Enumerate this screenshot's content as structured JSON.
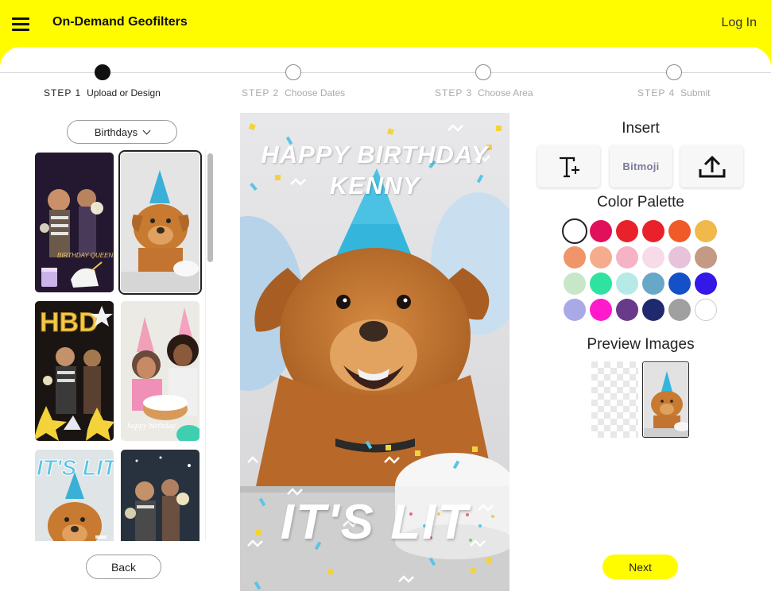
{
  "header": {
    "title": "On-Demand Geofilters",
    "login_label": "Log In"
  },
  "steps": [
    {
      "num": "STEP 1",
      "label": "Upload or Design",
      "state": "current"
    },
    {
      "num": "STEP 2",
      "label": "Choose Dates",
      "state": "upcoming"
    },
    {
      "num": "STEP 3",
      "label": "Choose Area",
      "state": "upcoming"
    },
    {
      "num": "STEP 4",
      "label": "Submit",
      "state": "upcoming"
    }
  ],
  "templates": {
    "category": "Birthdays",
    "items": [
      {
        "id": "birthday-queen",
        "text": "BIRTHDAY QUEEN",
        "selected": false
      },
      {
        "id": "dog-party-hat",
        "selected": true
      },
      {
        "id": "hbd",
        "text": "HBD",
        "selected": false
      },
      {
        "id": "girl-cake",
        "text": "happy birthday",
        "selected": false
      },
      {
        "id": "its-lit-dog",
        "text": "IT'S LIT",
        "selected": false
      },
      {
        "id": "sparklers",
        "selected": false
      }
    ]
  },
  "canvas": {
    "top_text_line1": "HAPPY BIRTHDAY",
    "top_text_line2": "KENNY",
    "bottom_text": "IT'S LIT"
  },
  "insert": {
    "heading": "Insert",
    "tools": [
      {
        "name": "text-tool",
        "icon": "text-plus-icon"
      },
      {
        "name": "bitmoji-tool",
        "label": "Bitmoji",
        "icon": "bitmoji-icon"
      },
      {
        "name": "upload-tool",
        "icon": "upload-icon"
      }
    ]
  },
  "palette": {
    "heading": "Color Palette",
    "selected": "#ffffff",
    "colors": [
      "#ffffff",
      "#e0105a",
      "#e8212a",
      "#e8212a",
      "#f05a28",
      "#f0b94a",
      "#f0946a",
      "#f6ab8e",
      "#f6b3c6",
      "#f7dbe8",
      "#e6c3d8",
      "#c49a85",
      "#c8e6c8",
      "#2ee3a0",
      "#b5eae6",
      "#67a8c8",
      "#1450c8",
      "#3318e8",
      "#a9a9e8",
      "#ff1acb",
      "#6a3a8a",
      "#1f2a6e",
      "#a0a0a0",
      "#ffffff"
    ]
  },
  "preview": {
    "heading": "Preview Images"
  },
  "footer": {
    "back_label": "Back",
    "next_label": "Next"
  }
}
